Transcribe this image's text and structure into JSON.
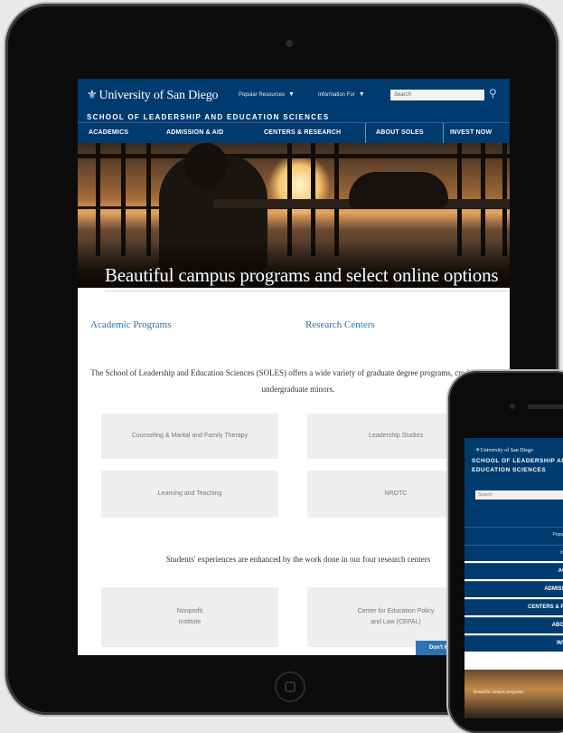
{
  "site": {
    "logo_text": "University of San Diego",
    "logo_icon": "seal-icon",
    "top_links": [
      {
        "label": "Popular Resources"
      },
      {
        "label": "Information For"
      }
    ],
    "search_placeholder": "Search",
    "school_name": "SCHOOL OF LEADERSHIP AND EDUCATION SCIENCES",
    "nav": [
      {
        "label": "ACADEMICS"
      },
      {
        "label": "ADMISSION & AID"
      },
      {
        "label": "CENTERS & RESEARCH"
      },
      {
        "label": "ABOUT SOLES"
      },
      {
        "label": "INVEST NOW"
      }
    ]
  },
  "hero": {
    "title": "Beautiful campus programs and select online options"
  },
  "tabs": [
    {
      "label": "Academic Programs"
    },
    {
      "label": "Research Centers"
    }
  ],
  "intro": {
    "text": "The School of Leadership and Education Sciences (SOLES) offers a wide variety of graduate degree programs, credentials, and undergraduate minors."
  },
  "program_cards": [
    {
      "label": "Counseling & Marital and Family Therapy"
    },
    {
      "label": "Leadership Studies"
    },
    {
      "label": "Learning and Teaching"
    },
    {
      "label": "NROTC"
    }
  ],
  "research_text": "Students' experiences are enhanced by the work done in our four research centers",
  "research_cards": [
    {
      "line1": "Nonprofit",
      "line2": "Institute"
    },
    {
      "line1": "Center for Education Policy",
      "line2": "and Law (CEPAL)"
    }
  ],
  "dont_miss_label": "Don't Miss",
  "phone": {
    "logo_text": "University of San Diego",
    "school_line1": "SCHOOL OF LEADERSHIP AND",
    "school_line2": "EDUCATION SCIENCES",
    "search_placeholder": "Search",
    "menu": [
      {
        "label": "Popular Resources",
        "style": "light"
      },
      {
        "label": "Information For",
        "style": "light"
      },
      {
        "label": "ACADEMICS",
        "style": "bold"
      },
      {
        "label": "ADMISSION & AID",
        "style": "bold"
      },
      {
        "label": "CENTERS & RESEARCH",
        "style": "bold"
      },
      {
        "label": "ABOUT SOLES",
        "style": "bold"
      },
      {
        "label": "INVEST NOW",
        "style": "bold"
      }
    ],
    "hero_title": "Beautiful campus programs"
  },
  "colors": {
    "navy": "#003b70",
    "link_blue": "#2f6da8",
    "button_blue": "#2e74b5",
    "card_grey": "#eeeeee"
  }
}
